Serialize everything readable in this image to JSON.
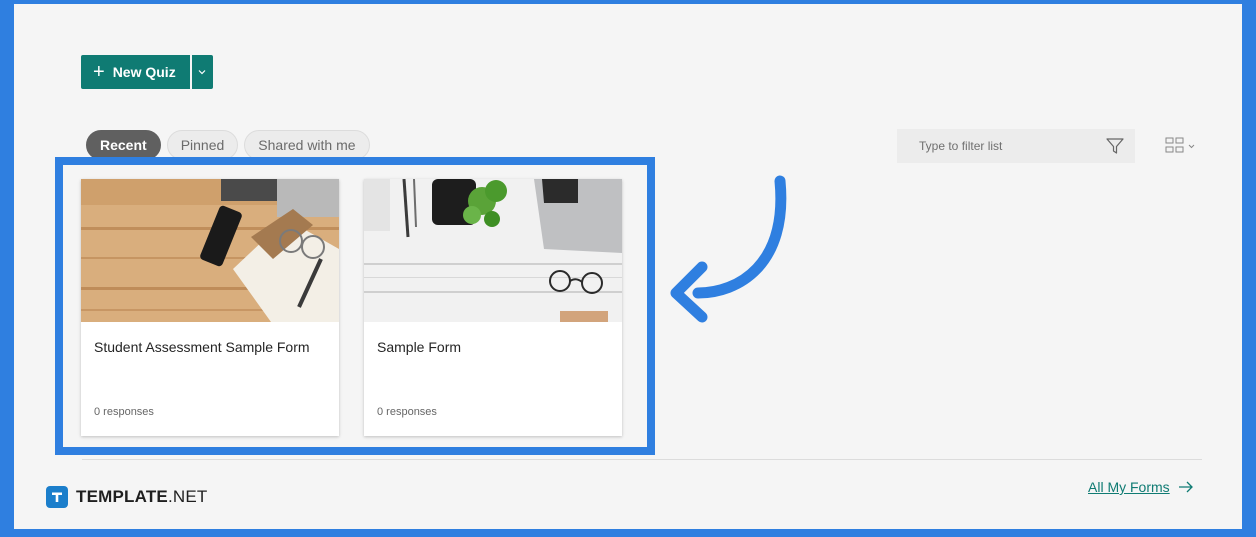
{
  "toolbar": {
    "new_quiz_label": "New Quiz"
  },
  "tabs": [
    {
      "label": "Recent",
      "active": true
    },
    {
      "label": "Pinned",
      "active": false
    },
    {
      "label": "Shared with me",
      "active": false
    }
  ],
  "filter": {
    "placeholder": "Type to filter list",
    "icon": "filter-icon"
  },
  "view_toggle": {
    "icon": "grid-view-icon"
  },
  "forms": [
    {
      "title": "Student Assessment Sample Form",
      "responses": "0 responses"
    },
    {
      "title": "Sample Form",
      "responses": "0 responses"
    }
  ],
  "footer": {
    "all_forms_label": "All My Forms",
    "logo_main": "TEMPLATE",
    "logo_suffix": ".NET"
  },
  "colors": {
    "brand_teal": "#0f7b73",
    "annotation_blue": "#2f7fe0",
    "logo_blue": "#1b7ecb"
  }
}
